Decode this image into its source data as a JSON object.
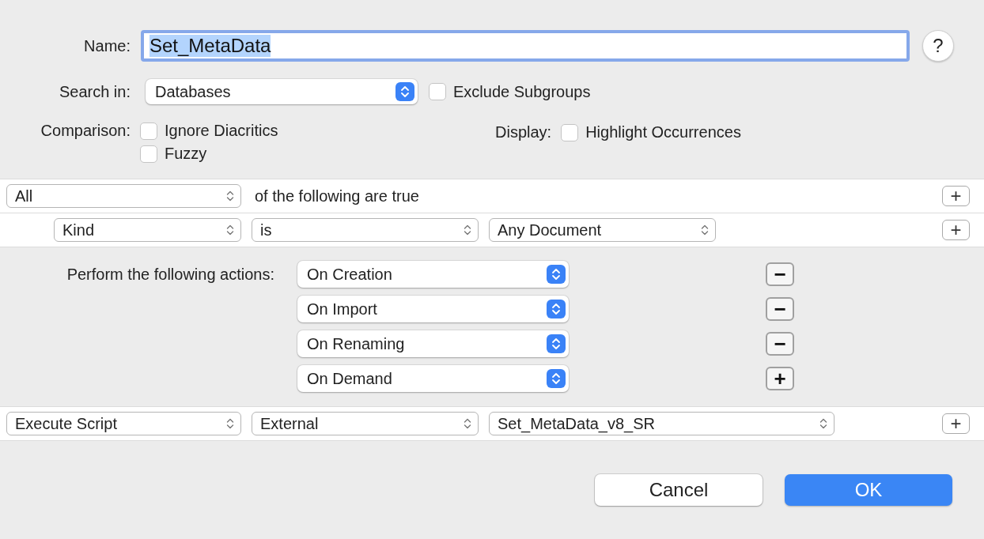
{
  "name_field": {
    "label": "Name:",
    "value": "Set_MetaData",
    "text_selected": true
  },
  "help_button": {
    "label": "?"
  },
  "search_in": {
    "label": "Search in:",
    "value": "Databases"
  },
  "exclude_subgroups": {
    "label": "Exclude Subgroups",
    "checked": false
  },
  "comparison": {
    "label": "Comparison:",
    "options": [
      {
        "label": "Ignore Diacritics",
        "checked": false
      },
      {
        "label": "Fuzzy",
        "checked": false
      }
    ]
  },
  "display": {
    "label": "Display:",
    "options": [
      {
        "label": "Highlight Occurrences",
        "checked": false
      }
    ]
  },
  "criteria": {
    "match": "All",
    "match_text": "of the following are true",
    "add_button": "+",
    "rows": [
      {
        "field": "Kind",
        "operator": "is",
        "value": "Any Document",
        "add_button": "+"
      }
    ]
  },
  "actions": {
    "label": "Perform the following actions:",
    "triggers": [
      {
        "value": "On Creation",
        "button": "−"
      },
      {
        "value": "On Import",
        "button": "−"
      },
      {
        "value": "On Renaming",
        "button": "−"
      },
      {
        "value": "On Demand",
        "button": "+"
      }
    ]
  },
  "script_row": {
    "action": "Execute Script",
    "source": "External",
    "script": "Set_MetaData_v8_SR",
    "add_button": "+"
  },
  "buttons": [
    {
      "label": "Cancel",
      "kind": "default"
    },
    {
      "label": "OK",
      "kind": "primary"
    }
  ]
}
